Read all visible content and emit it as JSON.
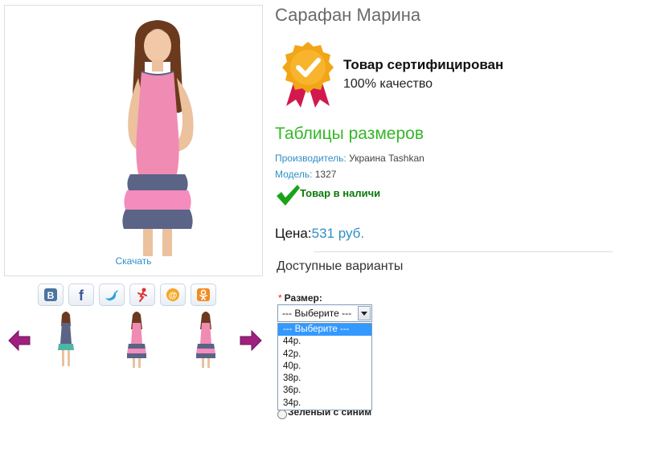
{
  "product": {
    "title": "Сарафан Марина",
    "download_label": "Скачать"
  },
  "certificate": {
    "title": "Товар сертифицирован",
    "subtitle": "100% качество"
  },
  "size_table_label": "Таблицы размеров",
  "details": {
    "manufacturer_key": "Производитель:",
    "manufacturer_value": "Украина Tashkan",
    "model_key": "Модель:",
    "model_value": "1327",
    "stock_label": "Товар в наличи"
  },
  "price": {
    "label": "Цена:",
    "value": "531 руб."
  },
  "options": {
    "heading": "Доступные варианты",
    "required_mark": "*",
    "size_label": "Размер:",
    "select_value": "--- Выберите ---",
    "dropdown_options": [
      "--- Выберите ---",
      "44р.",
      "42р.",
      "40р.",
      "38р.",
      "36р.",
      "34р."
    ],
    "selected_index": 0,
    "color_option_label": "Зеленый с синим"
  },
  "share_icons": [
    "vk-icon",
    "facebook-icon",
    "twitter-icon",
    "odnoklassniki-figure-icon",
    "mail-ru-icon",
    "ok-icon"
  ],
  "thumbnails": [
    "thumbnail-dress-blue",
    "thumbnail-dress-pink-1",
    "thumbnail-dress-pink-2"
  ],
  "colors": {
    "accent_blue": "#2f8fc7",
    "size_table_green": "#33b827",
    "stock_green": "#0a7a0a",
    "arrow_purple": "#a0207f",
    "badge_gold": "#f2a516"
  }
}
